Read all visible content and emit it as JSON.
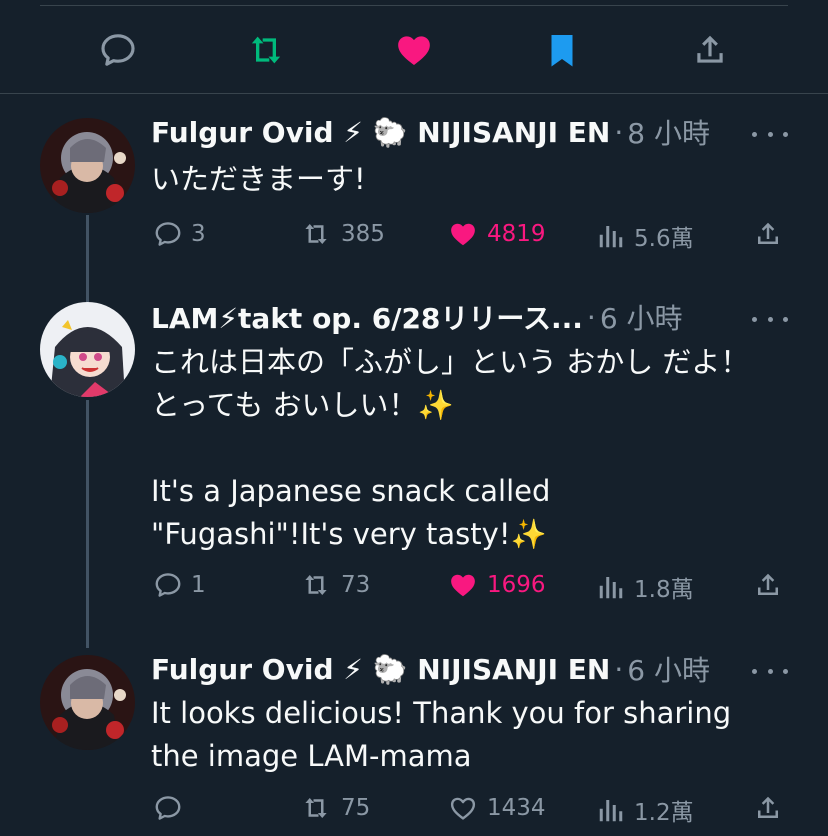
{
  "top_actions": {
    "reply_icon": "reply-icon",
    "retweet_icon": "retweet-icon",
    "like_icon": "heart-icon",
    "bookmark_icon": "bookmark-icon",
    "share_icon": "share-icon",
    "colors": {
      "retweet": "#00ba7c",
      "like": "#f91880",
      "bookmark": "#1d9bf0"
    }
  },
  "tweets": [
    {
      "author": "Fulgur Ovid ⚡ 🐑 NIJISANJI EN",
      "dot": "·",
      "time": "8 小時",
      "text": "いただきまーす!",
      "replies": "3",
      "retweets": "385",
      "likes": "4819",
      "liked": true,
      "views": "5.6萬"
    },
    {
      "author": "LAM⚡takt op. 6/28リリース...",
      "dot": "·",
      "time": "6 小時",
      "text": "これは日本の「ふがし」という おかし だよ！とっても おいしい！✨\n\nIt's a Japanese snack called \"Fugashi\"!It's very tasty!✨",
      "replies": "1",
      "retweets": "73",
      "likes": "1696",
      "liked": true,
      "views": "1.8萬"
    },
    {
      "author": "Fulgur Ovid ⚡ 🐑 NIJISANJI EN",
      "dot": "·",
      "time": "6 小時",
      "text": "It looks delicious! Thank you for sharing the image LAM-mama",
      "replies": "",
      "retweets": "75",
      "likes": "1434",
      "liked": false,
      "views": "1.2萬"
    }
  ]
}
